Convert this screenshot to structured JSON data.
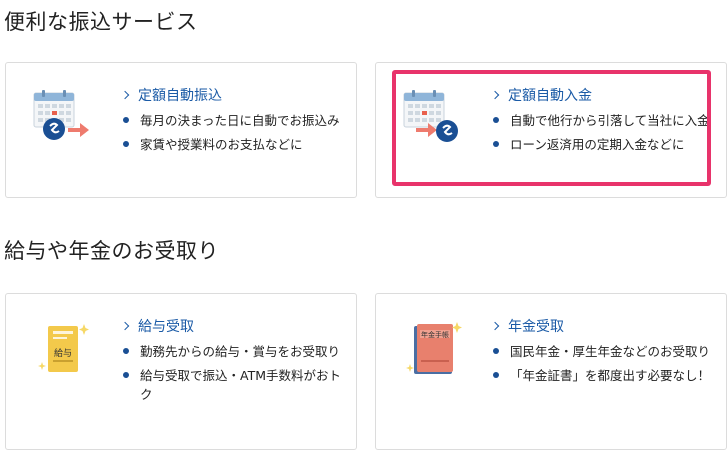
{
  "sections": [
    {
      "title": "便利な振込サービス"
    },
    {
      "title": "給与や年金のお受取り"
    }
  ],
  "cards": [
    {
      "link": "定額自動振込",
      "bullets": [
        "毎月の決まった日に自動でお振込み",
        "家賃や授業料のお支払などに"
      ],
      "icon": "calendar-transfer-icon"
    },
    {
      "link": "定額自動入金",
      "bullets": [
        "自動で他行から引落して当社に入金",
        "ローン返済用の定期入金などに"
      ],
      "icon": "calendar-deposit-icon",
      "highlighted": true
    },
    {
      "link": "給与受取",
      "bullets": [
        "勤務先からの給与・賞与をお受取り",
        "給与受取で振込・ATM手数料がおトク"
      ],
      "icon": "salary-envelope-icon",
      "icon_label": "給与"
    },
    {
      "link": "年金受取",
      "bullets": [
        "国民年金・厚生年金などのお受取り",
        "「年金証書」を都度出す必要なし！"
      ],
      "icon": "pension-book-icon",
      "icon_label": "年金手帳"
    }
  ],
  "colors": {
    "link": "#1a5aa6",
    "bullet": "#1a4f94",
    "highlight": "#e8336b",
    "accent_arrow": "#ee7b6e",
    "coin": "#1a4f94",
    "envelope": "#f3c94b",
    "pension_book": "#e8806d"
  }
}
